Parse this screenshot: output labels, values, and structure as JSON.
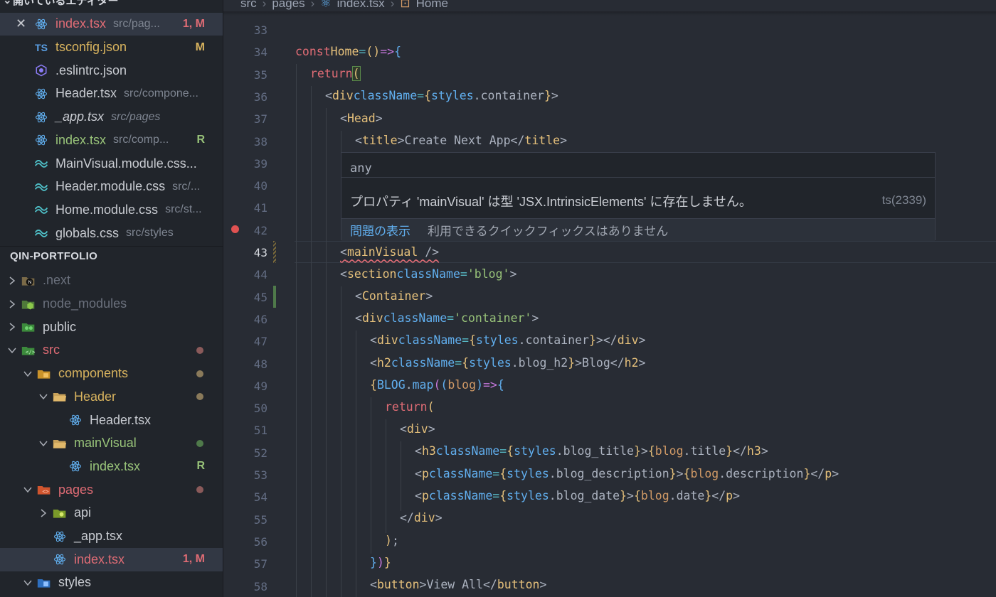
{
  "sidebar": {
    "open_editors_title": "開いているエディター",
    "open_editors": [
      {
        "name": "index.tsx",
        "desc": "src/pag...",
        "badge": "1, M",
        "icon": "react-icon",
        "tone": "red",
        "active": true,
        "close": "✕"
      },
      {
        "name": "tsconfig.json",
        "desc": "",
        "badge": "M",
        "icon": "typescript-icon",
        "tone": "yellow"
      },
      {
        "name": ".eslintrc.json",
        "desc": "",
        "badge": "",
        "icon": "eslint-icon",
        "tone": "plain"
      },
      {
        "name": "Header.tsx",
        "desc": "src/compone...",
        "badge": "",
        "icon": "react-icon",
        "tone": "plain"
      },
      {
        "name": "_app.tsx",
        "desc": "src/pages",
        "badge": "",
        "icon": "react-icon",
        "tone": "plain",
        "italic": true
      },
      {
        "name": "index.tsx",
        "desc": "src/comp...",
        "badge": "R",
        "icon": "react-icon",
        "tone": "green"
      },
      {
        "name": "MainVisual.module.css...",
        "desc": "",
        "badge": "",
        "icon": "tailwind-icon",
        "tone": "plain"
      },
      {
        "name": "Header.module.css",
        "desc": "src/...",
        "badge": "",
        "icon": "tailwind-icon",
        "tone": "plain"
      },
      {
        "name": "Home.module.css",
        "desc": "src/st...",
        "badge": "",
        "icon": "tailwind-icon",
        "tone": "plain"
      },
      {
        "name": "globals.css",
        "desc": "src/styles",
        "badge": "",
        "icon": "tailwind-icon",
        "tone": "plain"
      }
    ],
    "project_title": "QIN-PORTFOLIO",
    "tree": [
      {
        "name": ".next",
        "depth": 0,
        "chev": "right",
        "icon": "next-folder-icon",
        "tone": "dim"
      },
      {
        "name": "node_modules",
        "depth": 0,
        "chev": "right",
        "icon": "node-folder-icon",
        "tone": "dim"
      },
      {
        "name": "public",
        "depth": 0,
        "chev": "right",
        "icon": "public-folder-icon",
        "tone": "plain"
      },
      {
        "name": "src",
        "depth": 0,
        "chev": "down",
        "icon": "src-folder-icon",
        "tone": "red",
        "dot": "#8a5a5a"
      },
      {
        "name": "components",
        "depth": 1,
        "chev": "down",
        "icon": "components-folder-icon",
        "tone": "yellow",
        "dot": "#8a7a5a"
      },
      {
        "name": "Header",
        "depth": 2,
        "chev": "down",
        "icon": "folder-open-icon",
        "tone": "yellow",
        "dot": "#8a7a5a"
      },
      {
        "name": "Header.tsx",
        "depth": 3,
        "chev": "none",
        "icon": "react-icon",
        "tone": "plain"
      },
      {
        "name": "mainVisual",
        "depth": 2,
        "chev": "down",
        "icon": "folder-open-icon",
        "tone": "green",
        "dot": "#4f7a4a"
      },
      {
        "name": "index.tsx",
        "depth": 3,
        "chev": "none",
        "icon": "react-icon",
        "tone": "green",
        "badge": "R"
      },
      {
        "name": "pages",
        "depth": 1,
        "chev": "down",
        "icon": "pages-folder-icon",
        "tone": "red",
        "dot": "#8a5a5a"
      },
      {
        "name": "api",
        "depth": 2,
        "chev": "right",
        "icon": "api-folder-icon",
        "tone": "plain"
      },
      {
        "name": "_app.tsx",
        "depth": 2,
        "chev": "none",
        "icon": "react-icon",
        "tone": "plain"
      },
      {
        "name": "index.tsx",
        "depth": 2,
        "chev": "none",
        "icon": "react-icon",
        "tone": "red",
        "badge": "1, M",
        "active": true
      },
      {
        "name": "styles",
        "depth": 1,
        "chev": "down",
        "icon": "styles-folder-icon",
        "tone": "plain"
      }
    ]
  },
  "editor": {
    "breadcrumb": [
      "src",
      "pages",
      "index.tsx",
      "Home"
    ],
    "current_line": 43,
    "hover": {
      "type": "any",
      "message": "プロパティ 'mainVisual' は型 'JSX.IntrinsicElements' に存在しません。",
      "code": "ts(2339)",
      "view_problem": "問題の表示",
      "no_fix": "利用できるクイックフィックスはありません"
    }
  }
}
